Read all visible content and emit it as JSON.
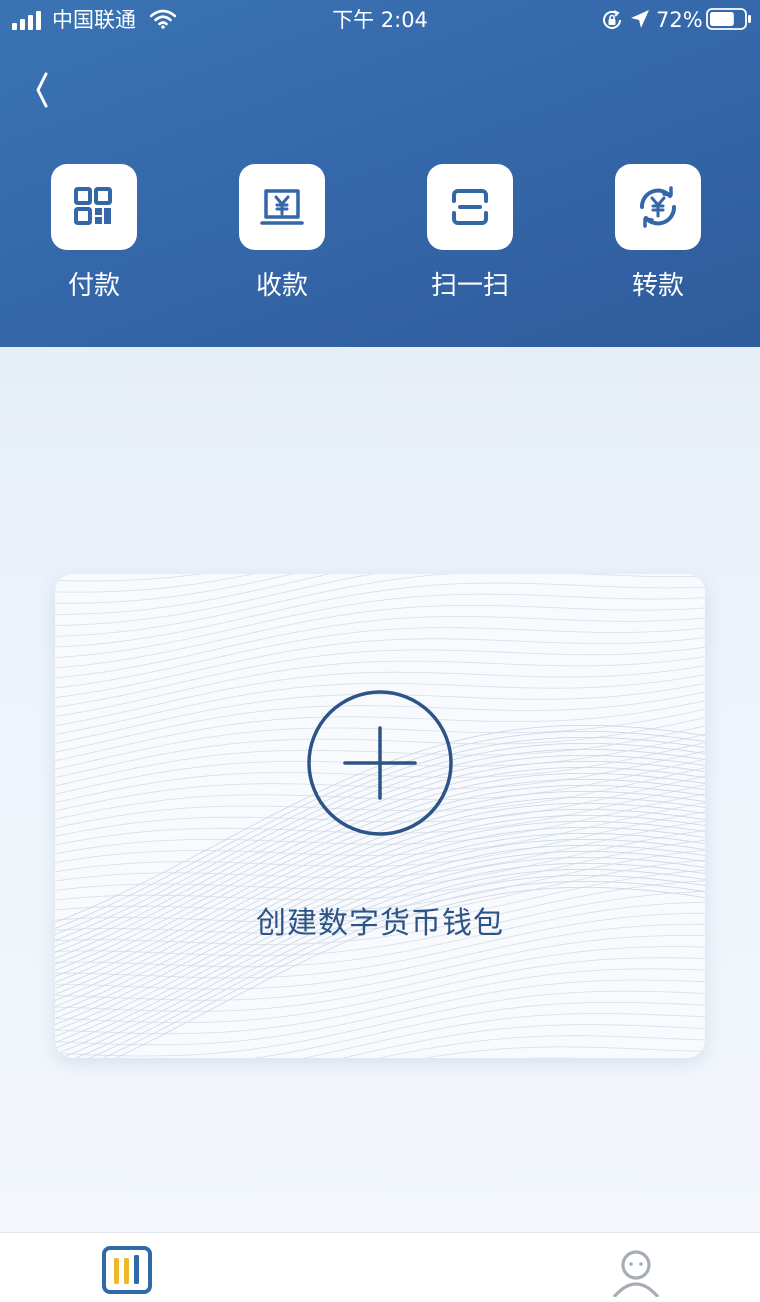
{
  "status_bar": {
    "carrier": "中国联通",
    "time": "下午 2:04",
    "battery": "72%",
    "battery_level": 0.72,
    "icons": [
      "signal-icon",
      "wifi-icon",
      "rotation-lock-icon",
      "location-arrow-icon",
      "battery-icon"
    ]
  },
  "header": {
    "back_icon": "chevron-left-icon",
    "actions": [
      {
        "label": "付款",
        "icon": "qr-code-icon"
      },
      {
        "label": "收款",
        "icon": "receive-yuan-icon"
      },
      {
        "label": "扫一扫",
        "icon": "scan-icon"
      },
      {
        "label": "转款",
        "icon": "transfer-yuan-icon"
      }
    ]
  },
  "wallet_card": {
    "icon": "plus-circle-icon",
    "label": "创建数字货币钱包"
  },
  "tab_bar": {
    "tabs": [
      {
        "icon": "wallet-tab-icon",
        "active": true
      },
      {
        "icon": "profile-tab-icon",
        "active": false
      }
    ]
  },
  "colors": {
    "header": "#3466a8",
    "accent_dark": "#2c5486",
    "tab_active_blue": "#2f6aa6",
    "tab_active_yellow": "#f0b829",
    "tab_inactive": "#a7adb5"
  }
}
